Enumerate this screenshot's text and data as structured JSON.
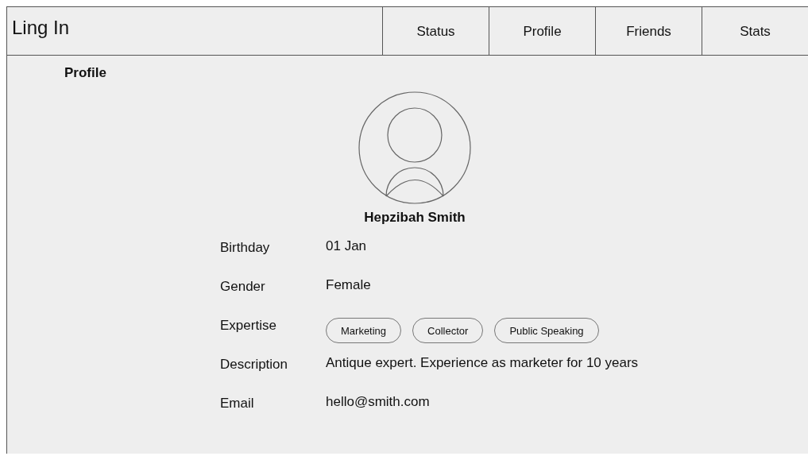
{
  "app": {
    "title": "Ling In"
  },
  "nav": [
    {
      "label": "Status"
    },
    {
      "label": "Profile"
    },
    {
      "label": "Friends"
    },
    {
      "label": "Stats"
    }
  ],
  "page": {
    "heading": "Profile"
  },
  "profile": {
    "name": "Hepzibah Smith",
    "fields": [
      {
        "kind": "text",
        "label": "Birthday",
        "value": "01 Jan"
      },
      {
        "kind": "text",
        "label": "Gender",
        "value": "Female"
      },
      {
        "kind": "tags",
        "label": "Expertise",
        "tags": [
          "Marketing",
          "Collector",
          "Public Speaking"
        ]
      },
      {
        "kind": "text",
        "label": "Description",
        "value": "Antique expert. Experience as marketer for 10 years"
      },
      {
        "kind": "text",
        "label": "Email",
        "value": "hello@smith.com"
      }
    ]
  }
}
